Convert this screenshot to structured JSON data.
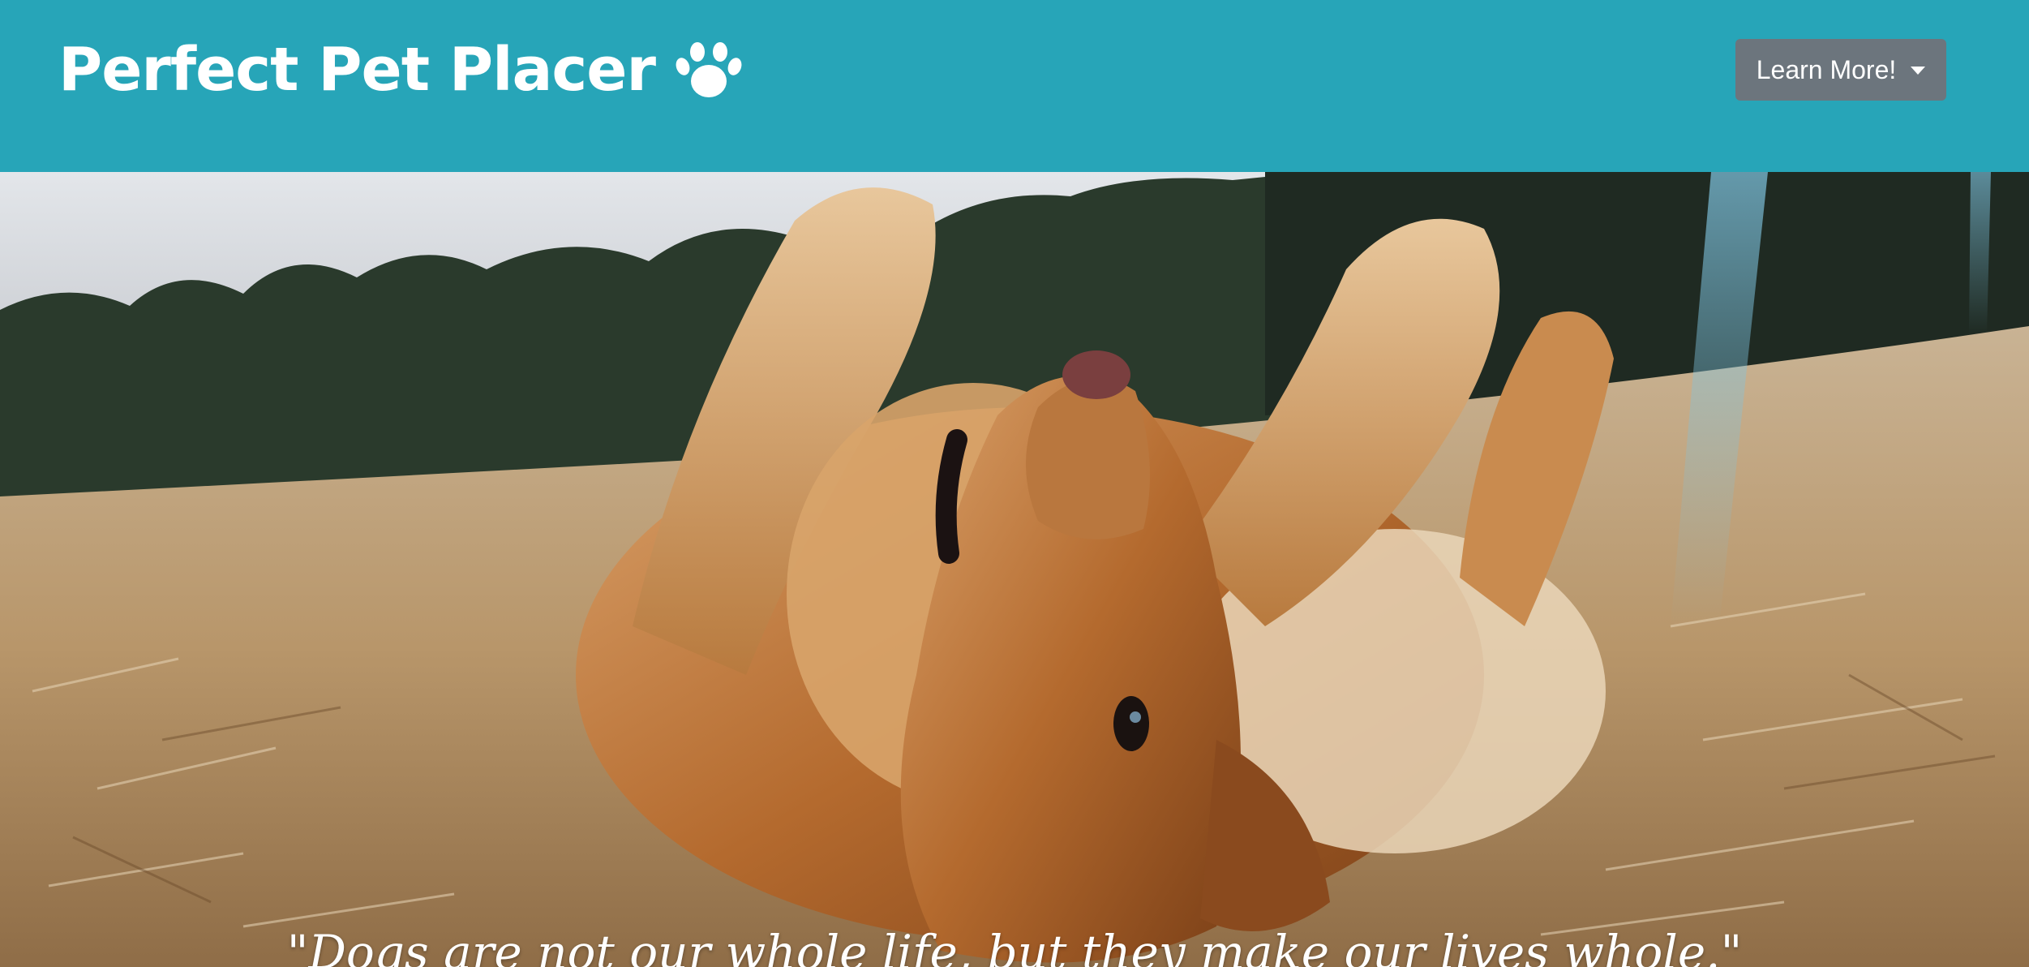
{
  "navbar": {
    "brand_text": "Perfect Pet Placer",
    "brand_icon": "paw-icon",
    "learn_more_label": "Learn More!",
    "dropdown_icon": "caret-down-icon",
    "background_color": "#27a5b8",
    "button_color": "#6c757d"
  },
  "hero": {
    "image_subject": "golden retriever rolling on its back in dry grass",
    "quote": "\"Dogs are not our whole life, but they make our lives whole.\""
  }
}
